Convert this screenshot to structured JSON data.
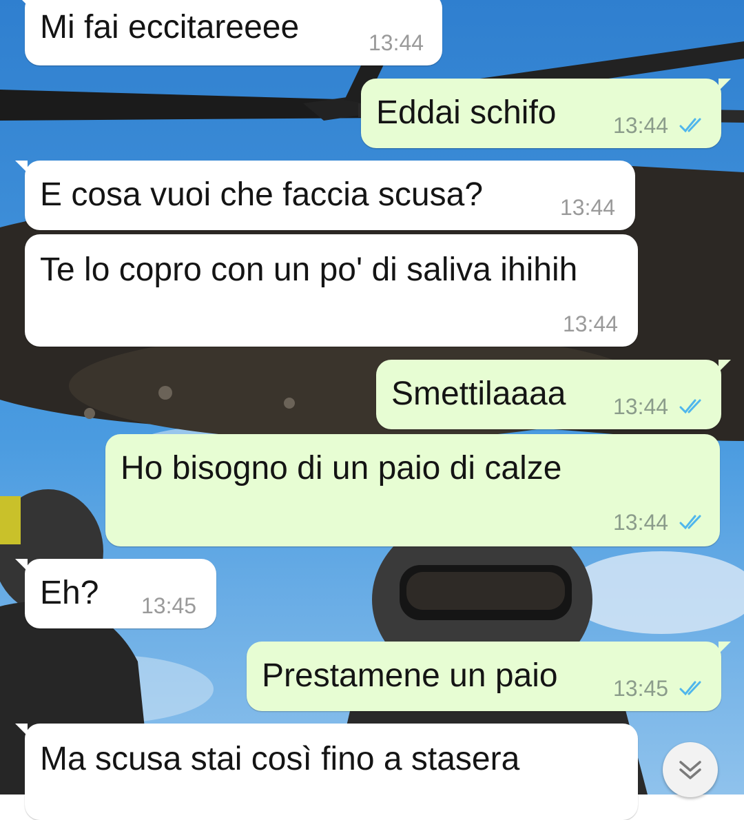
{
  "conversation": {
    "messages": [
      {
        "direction": "in",
        "text": "Mi fai eccitareeee",
        "time": "13:44"
      },
      {
        "direction": "out",
        "text": "Eddai schifo",
        "time": "13:44",
        "status": "read"
      },
      {
        "direction": "in",
        "text": "E cosa vuoi che faccia scusa?",
        "time": "13:44"
      },
      {
        "direction": "in",
        "text": "Te lo copro con un po' di saliva ihihih",
        "time": "13:44"
      },
      {
        "direction": "out",
        "text": "Smettilaaaa",
        "time": "13:44",
        "status": "read"
      },
      {
        "direction": "out",
        "text": "Ho bisogno di un paio di calze",
        "time": "13:44",
        "status": "read"
      },
      {
        "direction": "in",
        "text": "Eh?",
        "time": "13:45"
      },
      {
        "direction": "out",
        "text": "Prestamene un paio",
        "time": "13:45",
        "status": "read"
      },
      {
        "direction": "in",
        "text": "Ma scusa stai così fino a stasera",
        "time": ""
      }
    ]
  },
  "icons": {
    "read_ticks": "double-check-icon",
    "scroll_down": "chevron-double-down-icon"
  },
  "colors": {
    "incoming_bubble": "#ffffff",
    "outgoing_bubble": "#e7fdd3",
    "read_tick": "#4fb6ec",
    "sky": "#3e8fd6"
  }
}
